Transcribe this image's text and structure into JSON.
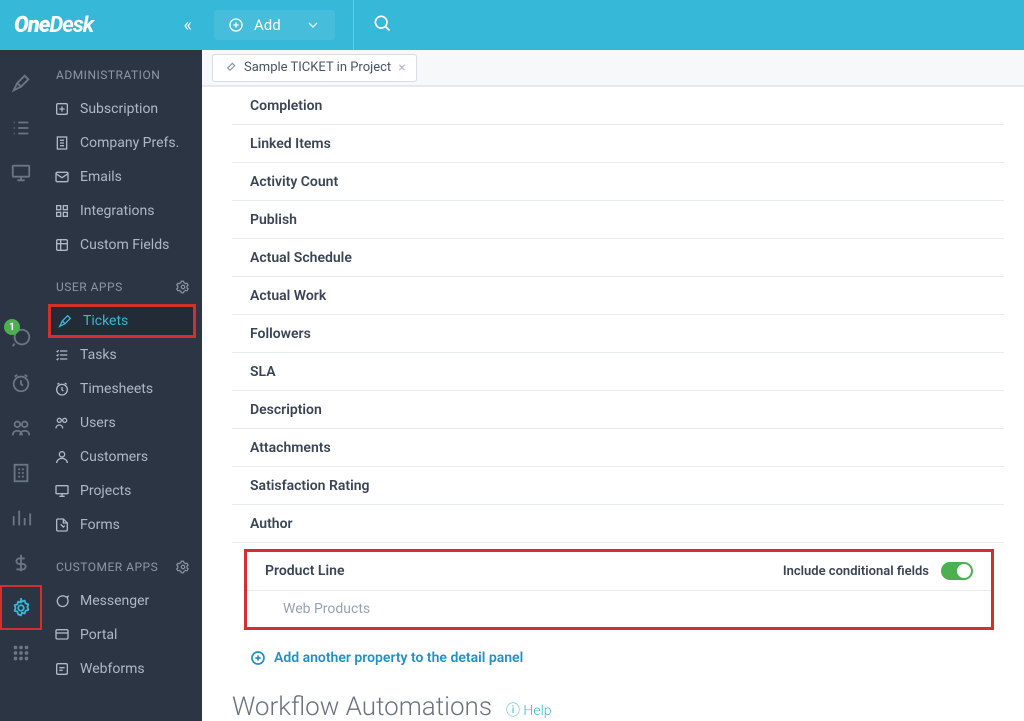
{
  "logo": {
    "prefix": "One",
    "suffix": "Desk"
  },
  "topbar": {
    "add_label": "Add"
  },
  "tab": {
    "title": "Sample TICKET in Project"
  },
  "sidebar": {
    "sections": {
      "administration": "ADMINISTRATION",
      "user_apps": "USER APPS",
      "customer_apps": "CUSTOMER APPS"
    },
    "administration": {
      "subscription": "Subscription",
      "company_prefs": "Company Prefs.",
      "emails": "Emails",
      "integrations": "Integrations",
      "custom_fields": "Custom Fields"
    },
    "user_apps": {
      "tickets": "Tickets",
      "tasks": "Tasks",
      "timesheets": "Timesheets",
      "users": "Users",
      "customers": "Customers",
      "projects": "Projects",
      "forms": "Forms"
    },
    "customer_apps": {
      "messenger": "Messenger",
      "portal": "Portal",
      "webforms": "Webforms"
    }
  },
  "rail": {
    "badge": "1"
  },
  "fields": {
    "completion": "Completion",
    "linked_items": "Linked Items",
    "activity_count": "Activity Count",
    "publish": "Publish",
    "actual_schedule": "Actual Schedule",
    "actual_work": "Actual Work",
    "followers": "Followers",
    "sla": "SLA",
    "description": "Description",
    "attachments": "Attachments",
    "satisfaction_rating": "Satisfaction Rating",
    "author": "Author",
    "product_line": "Product Line",
    "web_products": "Web Products",
    "conditional_label": "Include conditional fields",
    "add_property": "Add another property to the detail panel"
  },
  "workflow": {
    "heading": "Workflow Automations",
    "help": "Help"
  }
}
